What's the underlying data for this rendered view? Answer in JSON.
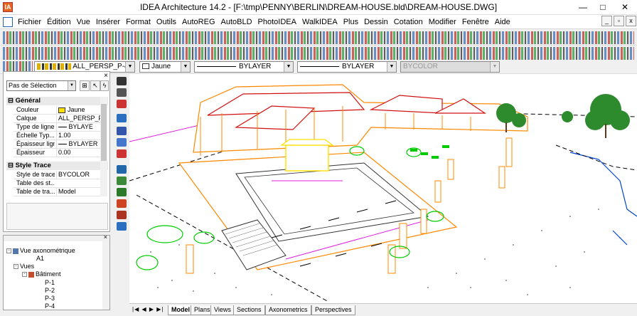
{
  "window": {
    "title": "IDEA Architecture 14.2  - [F:\\tmp\\PENNY\\BERLIN\\DREAM-HOUSE.bld\\DREAM-HOUSE.DWG]",
    "min": "—",
    "max": "□",
    "close": "✕"
  },
  "menu": [
    "Fichier",
    "Édition",
    "Vue",
    "Insérer",
    "Format",
    "Outils",
    "AutoREG",
    "AutoBLD",
    "PhotoIDEA",
    "WalkIDEA",
    "Plus",
    "Dessin",
    "Cotation",
    "Modifier",
    "Fenêtre",
    "Aide"
  ],
  "mdi": {
    "min": "_",
    "restore": "▫",
    "close": "x"
  },
  "props_toolbar": {
    "layer": "ALL_PERSP_P-4",
    "color": "Jaune",
    "linetype": "BYLAYER",
    "lineweight": "BYLAYER",
    "plotstyle": "BYCOLOR"
  },
  "properties": {
    "close": "×",
    "selection": "Pas de Sélection",
    "sections": [
      {
        "title": "Général",
        "rows": [
          {
            "key": "Couleur",
            "value": "Jaune"
          },
          {
            "key": "Calque",
            "value": "ALL_PERSP_P-4"
          },
          {
            "key": "Type de ligne",
            "value": "BYLAYE"
          },
          {
            "key": "Échelle Typ...",
            "value": "1.00"
          },
          {
            "key": "Épaisseur ligne",
            "value": "BYLAYER"
          },
          {
            "key": "Épaisseur",
            "value": "0.00"
          }
        ]
      },
      {
        "title": "Style Trace",
        "rows": [
          {
            "key": "Style de trace",
            "value": "BYCOLOR"
          },
          {
            "key": "Table des st...",
            "value": ""
          },
          {
            "key": "Table de tra...",
            "value": "Model"
          }
        ]
      }
    ]
  },
  "tree": {
    "close": "×",
    "items": [
      {
        "label": "Vue axonométrique",
        "level": 0,
        "expand": "-"
      },
      {
        "label": "A1",
        "level": 2
      },
      {
        "label": "Vues",
        "level": 1,
        "expand": "-"
      },
      {
        "label": "Bâtiment",
        "level": 2,
        "expand": "-"
      },
      {
        "label": "P-1",
        "level": 3
      },
      {
        "label": "P-2",
        "level": 3
      },
      {
        "label": "P-3",
        "level": 3
      },
      {
        "label": "P-4",
        "level": 3
      }
    ]
  },
  "tabs": {
    "nav": "|◀ ◀ ▶ ▶|",
    "items": [
      "Model",
      "Plans",
      "Views",
      "Sections",
      "Axonometrics",
      "Perspectives"
    ],
    "active": "Model"
  },
  "colors": {
    "accent": "#e8641b",
    "cad_orange": "#ff8800",
    "cad_red": "#d01010",
    "cad_green": "#00cc00",
    "cad_magenta": "#e020e0",
    "cad_blue": "#0044cc",
    "cad_yellow": "#ffe000"
  }
}
